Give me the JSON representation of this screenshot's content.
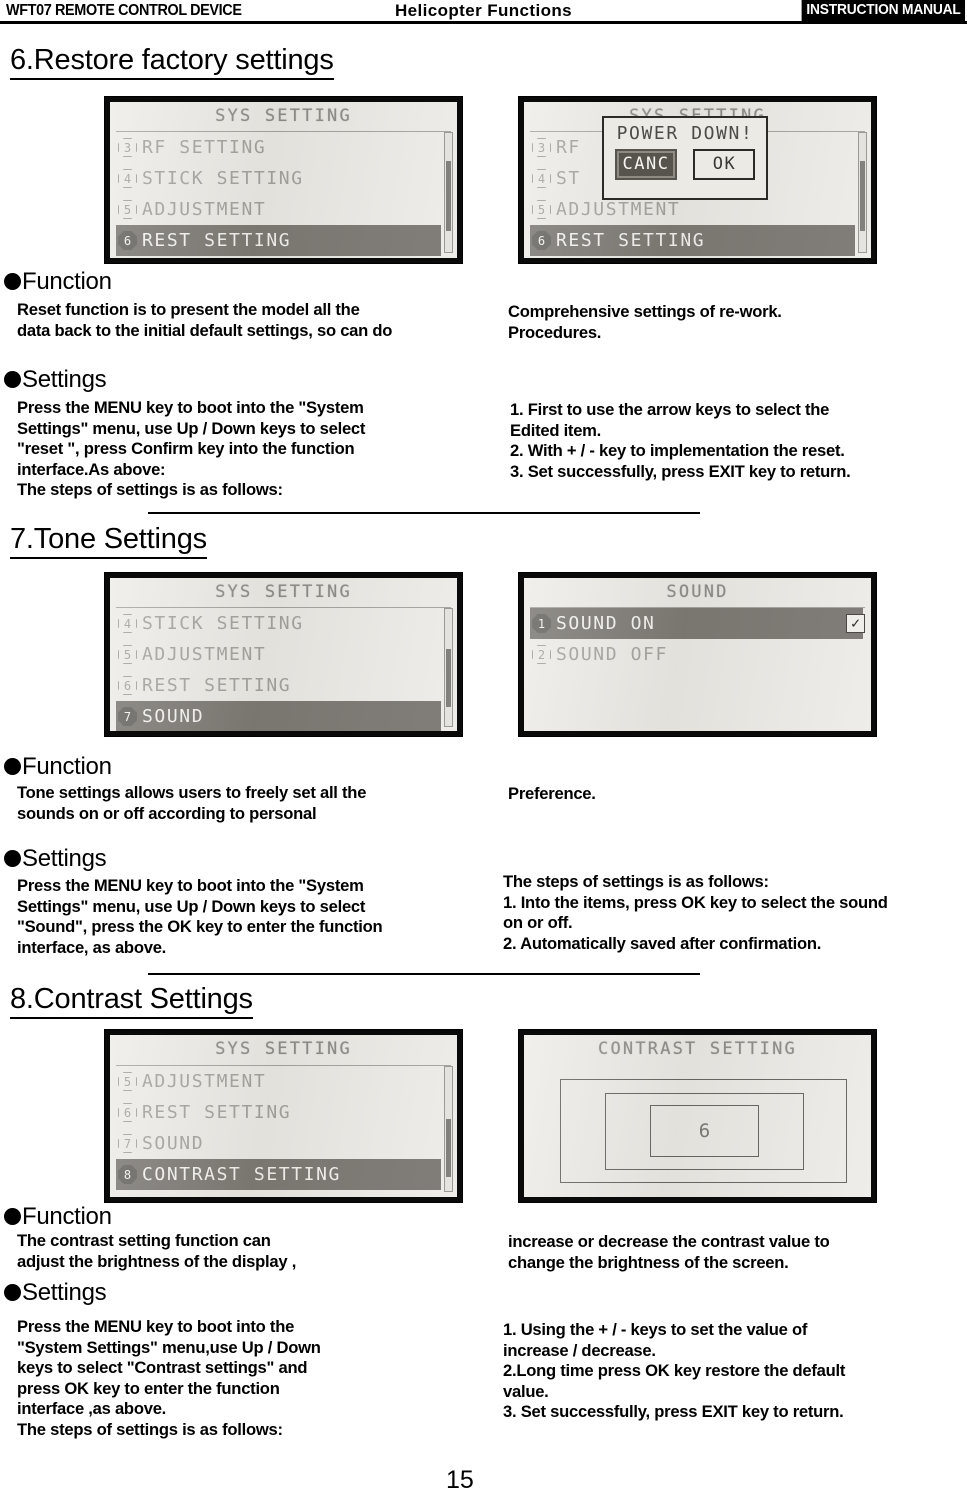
{
  "header": {
    "left_title": "WFT07 REMOTE CONTROL DEVICE",
    "center_title": "Helicopter Functions",
    "badge": "INSTRUCTION MANUAL"
  },
  "sections": [
    {
      "number": "6.",
      "title": "Restore factory settings",
      "function_label": "Function",
      "settings_label": "Settings",
      "function_left": "Reset function is to present the model all the\ndata back to the initial default settings, so can do",
      "function_right": "Comprehensive settings of re-work.\nProcedures.",
      "settings_left": "Press the MENU key to boot into the \"System\nSettings\" menu, use Up / Down keys to select\n\"reset \", press Confirm key into the function\ninterface.As above:\nThe steps of settings is as follows:",
      "settings_right": "1. First to use the arrow keys to select the\nEdited item.\n2. With + / - key to implementation the reset.\n3. Set successfully, press EXIT key to return.",
      "screen_left": {
        "title": "SYS SETTING",
        "items": [
          {
            "num": "3",
            "label": "RF SETTING",
            "selected": false
          },
          {
            "num": "4",
            "label": "STICK SETTING",
            "selected": false
          },
          {
            "num": "5",
            "label": "ADJUSTMENT",
            "selected": false
          },
          {
            "num": "6",
            "label": "REST SETTING",
            "selected": true
          }
        ]
      },
      "screen_right": {
        "title": "SYS SETTING",
        "items": [
          {
            "num": "3",
            "label": "RF",
            "selected": false
          },
          {
            "num": "4",
            "label": "ST",
            "selected": false
          },
          {
            "num": "5",
            "label": "ADJUSTMENT",
            "selected": false
          },
          {
            "num": "6",
            "label": "REST SETTING",
            "selected": true
          }
        ],
        "modal": {
          "title": "POWER DOWN!",
          "cancel_label": "CANC",
          "ok_label": "OK"
        }
      }
    },
    {
      "number": "7.",
      "title": "Tone Settings",
      "function_label": "Function",
      "settings_label": "Settings",
      "function_left": "Tone settings allows users to freely set all the\nsounds on or off according to personal",
      "function_right": "Preference.",
      "settings_left": "Press the MENU key to boot into the \"System\nSettings\" menu, use Up / Down keys to select\n\"Sound\", press the OK key to enter the function\ninterface, as above.",
      "settings_right": "   The steps of settings is as follows:\n 1. Into the items, press OK key to select the sound\non or off.\n2. Automatically saved after confirmation.",
      "screen_left": {
        "title": "SYS SETTING",
        "items": [
          {
            "num": "4",
            "label": "STICK SETTING",
            "selected": false
          },
          {
            "num": "5",
            "label": "ADJUSTMENT",
            "selected": false
          },
          {
            "num": "6",
            "label": "REST SETTING",
            "selected": false
          },
          {
            "num": "7",
            "label": "SOUND",
            "selected": true
          }
        ]
      },
      "screen_right": {
        "title": "SOUND",
        "items": [
          {
            "num": "1",
            "label": "SOUND ON",
            "selected": true,
            "checked": true
          },
          {
            "num": "2",
            "label": "SOUND OFF",
            "selected": false
          }
        ],
        "checkbox_glyph": "✓"
      }
    },
    {
      "number": "8.",
      "title": "Contrast Settings",
      "function_label": "Function",
      "settings_label": "Settings",
      "function_left": "The contrast setting function can\nadjust the brightness of the display ,",
      "function_right": "increase or decrease the contrast value to\nchange the brightness of the screen.",
      "settings_left": "Press the MENU key to boot into the\n\"System Settings\" menu,use Up / Down\nkeys to select \"Contrast settings\" and\npress OK key to enter the function\ninterface ,as above.\nThe steps of settings is as follows:",
      "settings_right": "1. Using the + / - keys to set the value of\nincrease / decrease.\n2.Long time press OK key restore the default\nvalue.\n3. Set successfully, press EXIT key to return.",
      "screen_left": {
        "title": "SYS SETTING",
        "items": [
          {
            "num": "5",
            "label": "ADJUSTMENT",
            "selected": false
          },
          {
            "num": "6",
            "label": "REST SETTING",
            "selected": false
          },
          {
            "num": "7",
            "label": "SOUND",
            "selected": false
          },
          {
            "num": "8",
            "label": "CONTRAST SETTING",
            "selected": true
          }
        ]
      },
      "screen_right": {
        "title": "CONTRAST SETTING",
        "contrast_value": "6"
      }
    }
  ],
  "page_number": "15"
}
